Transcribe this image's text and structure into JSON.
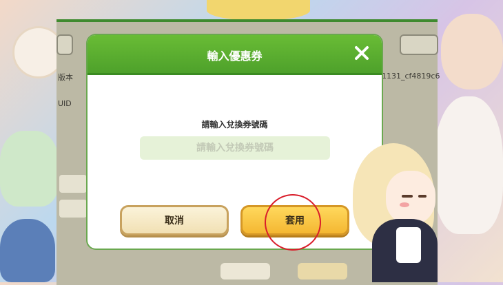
{
  "dialog": {
    "title": "輸入優惠券",
    "prompt": "請輸入兌換券號碼",
    "input_placeholder": "請輸入兌換券號碼",
    "input_value": "",
    "cancel_label": "取消",
    "apply_label": "套用"
  },
  "background_panel": {
    "version_label": "版本",
    "version_value": "1131_cf4819c6",
    "uid_label": "UID"
  },
  "colors": {
    "header_green": "#4ea12b",
    "apply_yellow": "#f4b732",
    "annotation_red": "#d91d2a"
  }
}
